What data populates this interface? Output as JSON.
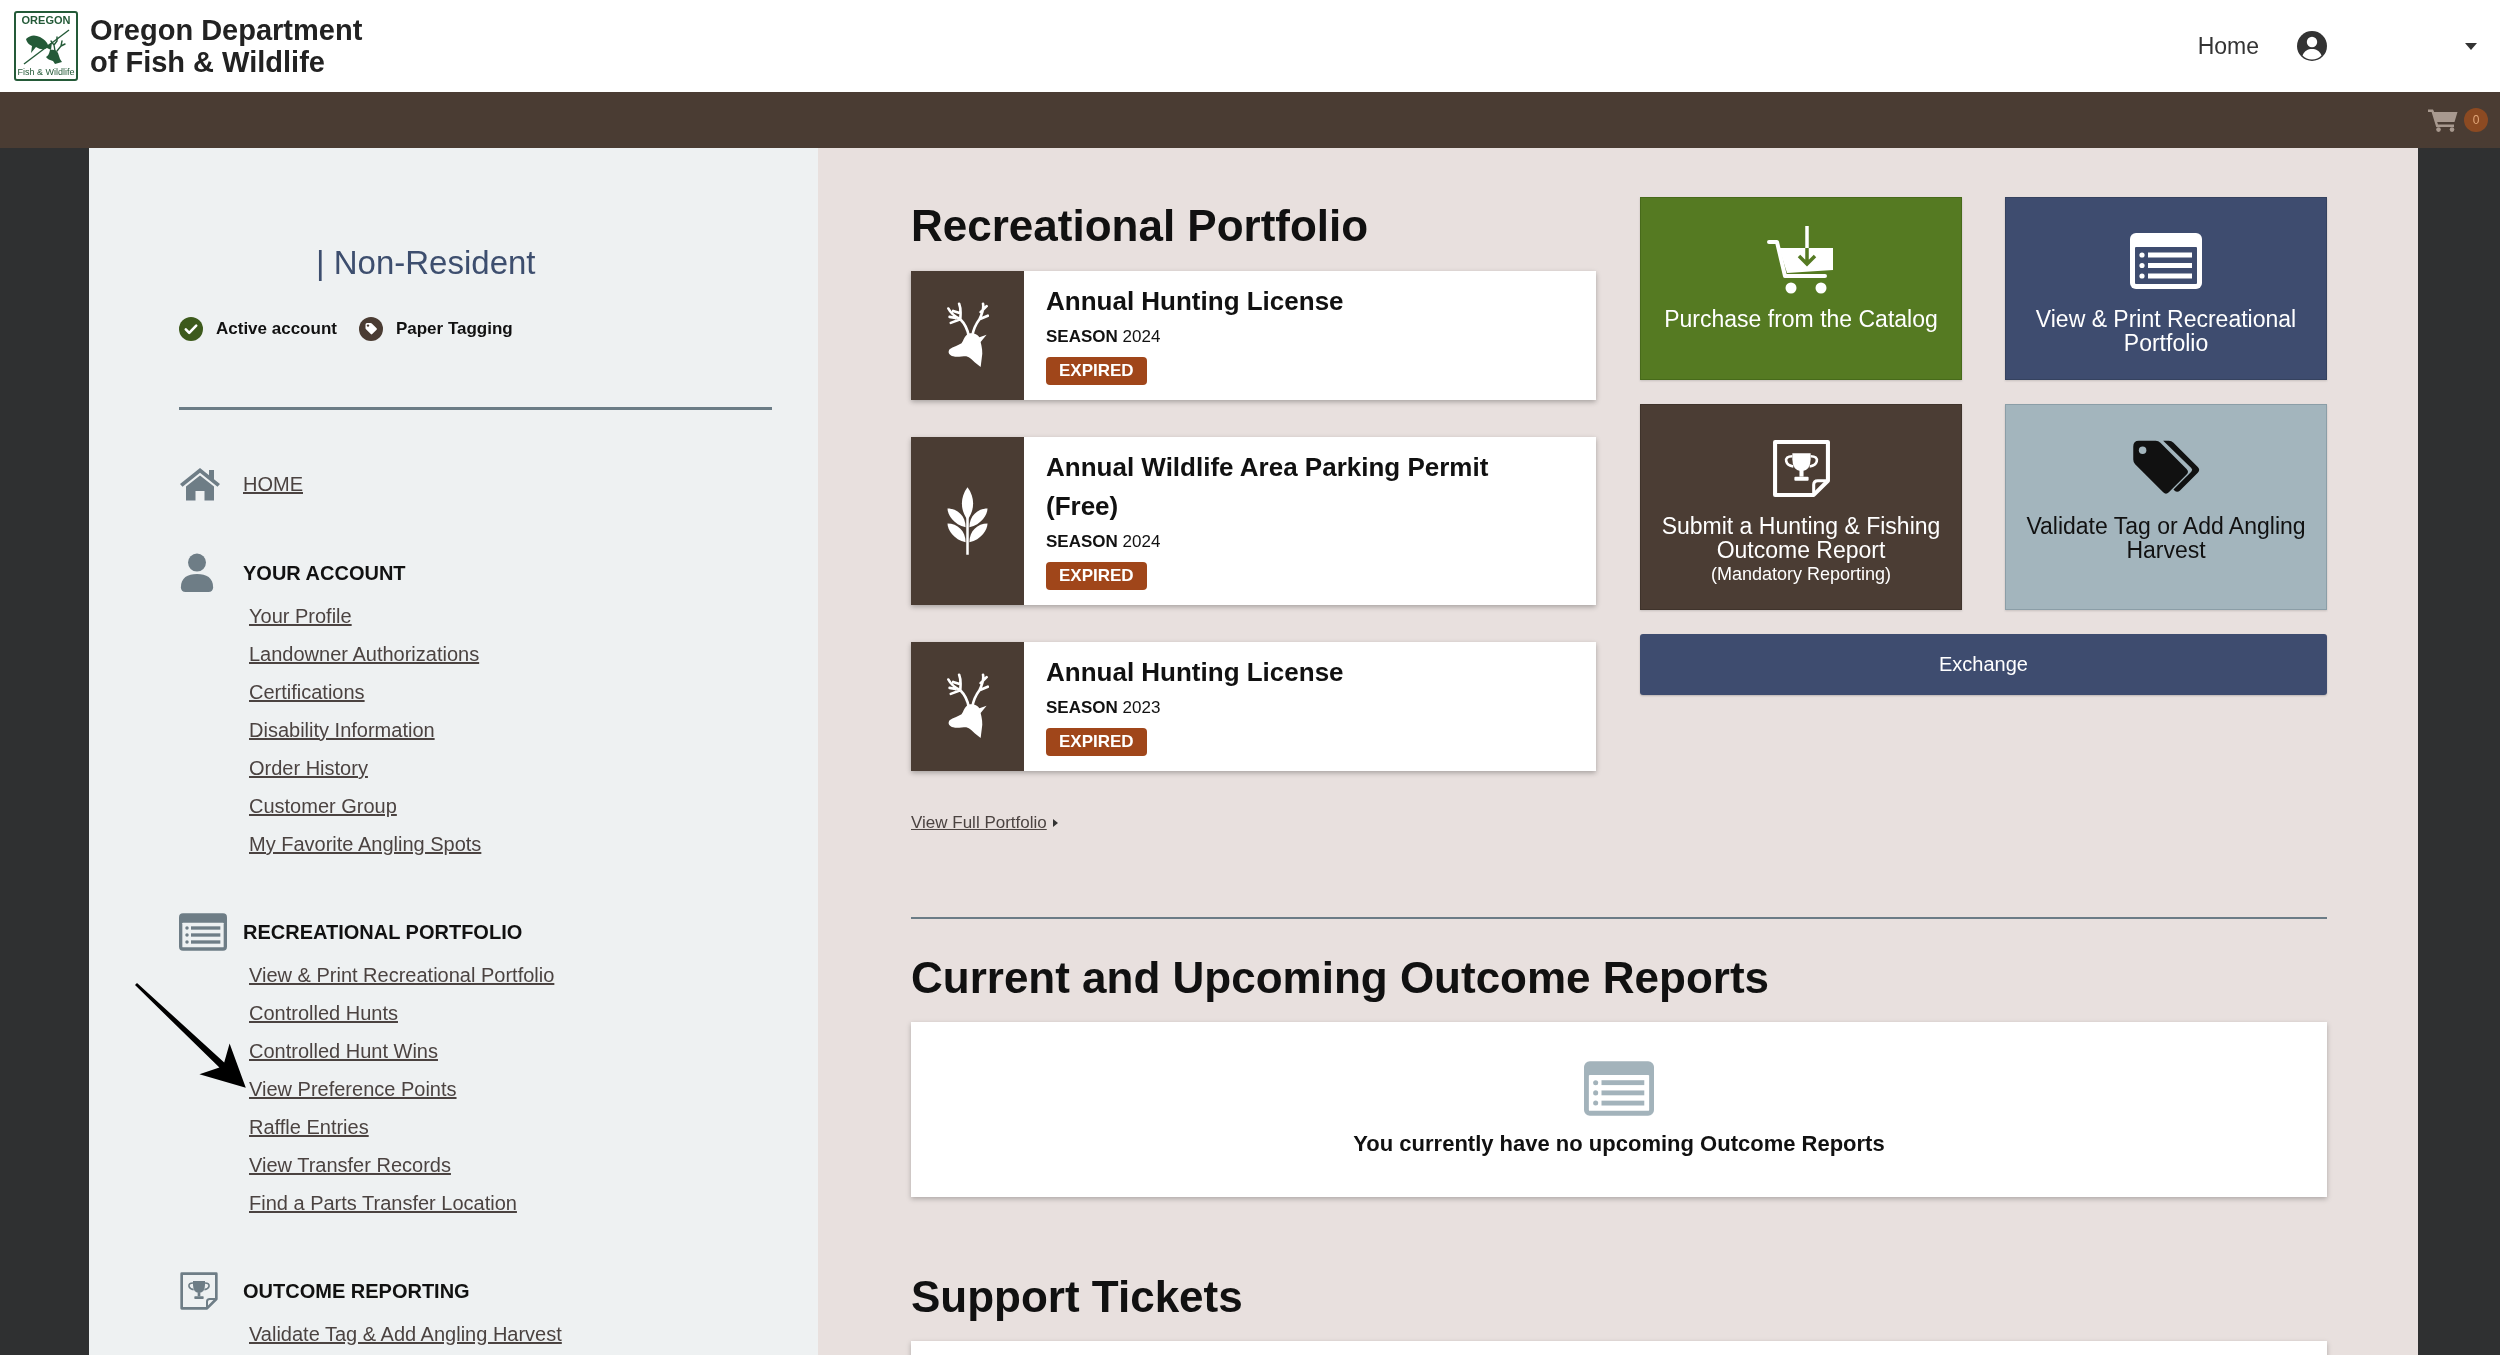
{
  "header": {
    "logo": {
      "top_text": "OREGON",
      "bottom_text": "Fish & Wildlife"
    },
    "title": "Oregon Department of Fish & Wildlife",
    "nav_link": "Home",
    "cart_count": "0"
  },
  "sidebar": {
    "residency": "| Non-Resident",
    "statuses": [
      {
        "kind": "active",
        "label": "Active account"
      },
      {
        "kind": "tag",
        "label": "Paper Tagging"
      }
    ],
    "home_link": "HOME",
    "sections": [
      {
        "kind": "account",
        "title": "YOUR ACCOUNT",
        "links": [
          {
            "label": "Your Profile",
            "pointed": false
          },
          {
            "label": "Landowner Authorizations",
            "pointed": false
          },
          {
            "label": "Certifications",
            "pointed": false
          },
          {
            "label": "Disability Information",
            "pointed": false
          },
          {
            "label": "Order History",
            "pointed": false
          },
          {
            "label": "Customer Group",
            "pointed": false
          },
          {
            "label": "My Favorite Angling Spots",
            "pointed": false
          }
        ]
      },
      {
        "kind": "portfolio",
        "title": "RECREATIONAL PORTFOLIO",
        "links": [
          {
            "label": "View & Print Recreational Portfolio",
            "pointed": false
          },
          {
            "label": "Controlled Hunts",
            "pointed": false
          },
          {
            "label": "Controlled Hunt Wins",
            "pointed": false
          },
          {
            "label": "View Preference Points",
            "pointed": true
          },
          {
            "label": "Raffle Entries",
            "pointed": false
          },
          {
            "label": "View Transfer Records",
            "pointed": false
          },
          {
            "label": "Find a Parts Transfer Location",
            "pointed": false
          }
        ]
      },
      {
        "kind": "outcome",
        "title": "OUTCOME REPORTING",
        "links": [
          {
            "label": "Validate Tag & Add Angling Harvest",
            "pointed": false
          }
        ]
      }
    ]
  },
  "portfolio": {
    "title": "Recreational Portfolio",
    "items": [
      {
        "kind": "deer",
        "name": "Annual Hunting License",
        "season": "**SEASON** 2024",
        "status": "EXPIRED"
      },
      {
        "kind": "plant",
        "name": "Annual Wildlife Area Parking Permit (Free)",
        "season": "**SEASON** 2024",
        "status": "EXPIRED"
      },
      {
        "kind": "deer",
        "name": "Annual Hunting License",
        "season": "**SEASON** 2023",
        "status": "EXPIRED"
      }
    ],
    "view_all_link": "View Full Portfolio"
  },
  "actions": {
    "tiles": [
      {
        "kind": "catalog",
        "label": "Purchase from the Catalog"
      },
      {
        "kind": "portfolio",
        "label": "View & Print Recreational Portfolio"
      },
      {
        "kind": "report",
        "label": "Submit a Hunting & Fishing Outcome Report",
        "note": "(Mandatory Reporting)"
      },
      {
        "kind": "tag",
        "label": "Validate Tag or Add Angling Harvest"
      }
    ],
    "exchange_button": "Exchange"
  },
  "outcome_reports": {
    "title": "Current and Upcoming Outcome Reports",
    "empty_message": "You currently have no upcoming Outcome Reports"
  },
  "support_tickets": {
    "title": "Support Tickets"
  }
}
